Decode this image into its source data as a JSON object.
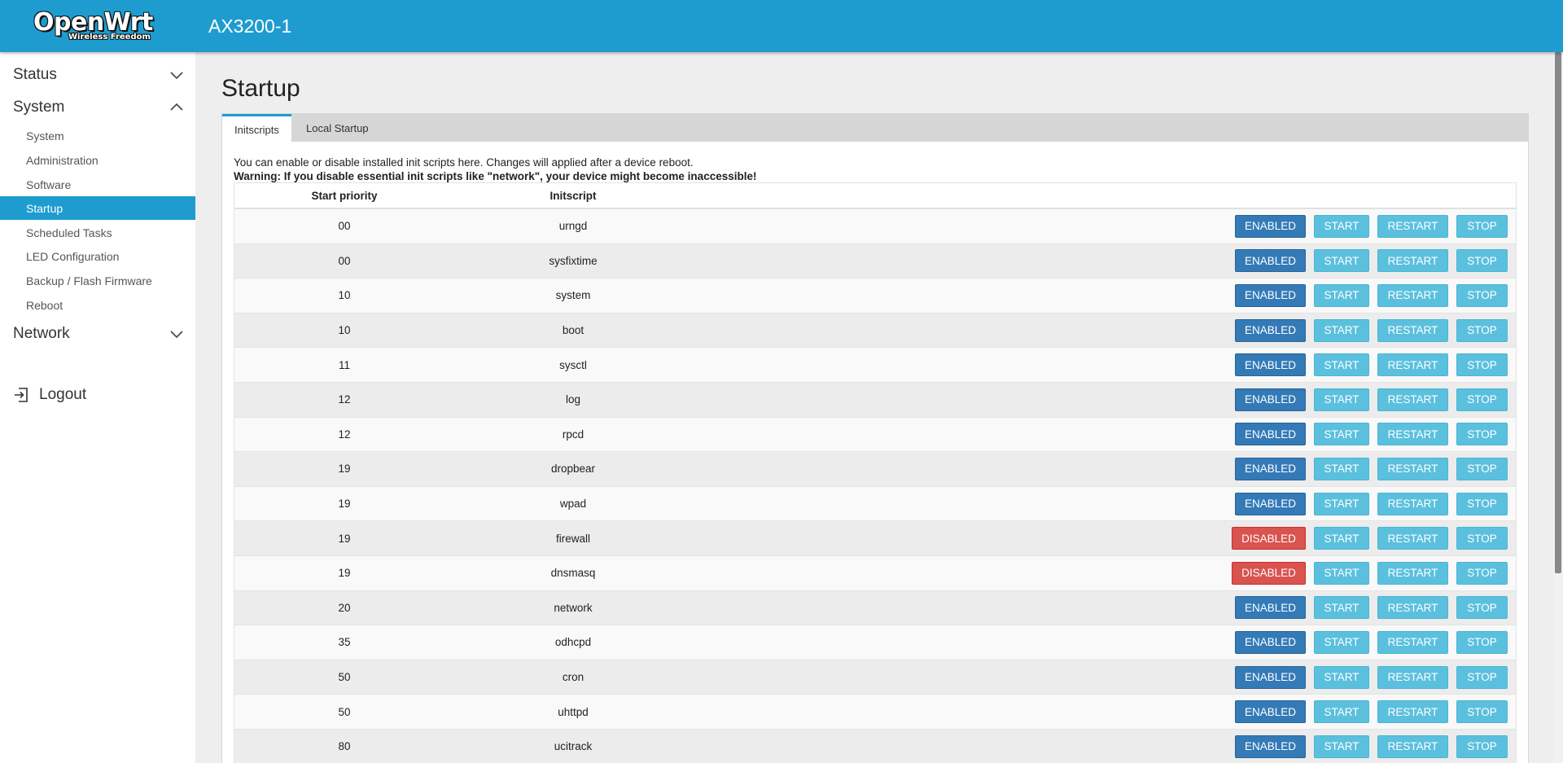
{
  "header": {
    "logo_main": "OpenWrt",
    "logo_sub": "Wireless Freedom",
    "hostname": "AX3200-1"
  },
  "sidebar": {
    "status_label": "Status",
    "system_label": "System",
    "network_label": "Network",
    "logout_label": "Logout",
    "system_items": [
      {
        "label": "System"
      },
      {
        "label": "Administration"
      },
      {
        "label": "Software"
      },
      {
        "label": "Startup"
      },
      {
        "label": "Scheduled Tasks"
      },
      {
        "label": "LED Configuration"
      },
      {
        "label": "Backup / Flash Firmware"
      },
      {
        "label": "Reboot"
      }
    ],
    "active_item": "Startup"
  },
  "main": {
    "title": "Startup",
    "tabs": [
      {
        "label": "Initscripts"
      },
      {
        "label": "Local Startup"
      }
    ],
    "description": "You can enable or disable installed init scripts here. Changes will applied after a device reboot.",
    "warning": "Warning: If you disable essential init scripts like \"network\", your device might become inaccessible!",
    "table": {
      "headers": {
        "priority": "Start priority",
        "script": "Initscript"
      },
      "start_label": "START",
      "restart_label": "RESTART",
      "stop_label": "STOP",
      "rows": [
        {
          "priority": "00",
          "script": "urngd",
          "state": "ENABLED"
        },
        {
          "priority": "00",
          "script": "sysfixtime",
          "state": "ENABLED"
        },
        {
          "priority": "10",
          "script": "system",
          "state": "ENABLED"
        },
        {
          "priority": "10",
          "script": "boot",
          "state": "ENABLED"
        },
        {
          "priority": "11",
          "script": "sysctl",
          "state": "ENABLED"
        },
        {
          "priority": "12",
          "script": "log",
          "state": "ENABLED"
        },
        {
          "priority": "12",
          "script": "rpcd",
          "state": "ENABLED"
        },
        {
          "priority": "19",
          "script": "dropbear",
          "state": "ENABLED"
        },
        {
          "priority": "19",
          "script": "wpad",
          "state": "ENABLED"
        },
        {
          "priority": "19",
          "script": "firewall",
          "state": "DISABLED"
        },
        {
          "priority": "19",
          "script": "dnsmasq",
          "state": "DISABLED"
        },
        {
          "priority": "20",
          "script": "network",
          "state": "ENABLED"
        },
        {
          "priority": "35",
          "script": "odhcpd",
          "state": "ENABLED"
        },
        {
          "priority": "50",
          "script": "cron",
          "state": "ENABLED"
        },
        {
          "priority": "50",
          "script": "uhttpd",
          "state": "ENABLED"
        },
        {
          "priority": "80",
          "script": "ucitrack",
          "state": "ENABLED"
        }
      ]
    }
  },
  "colors": {
    "brand": "#1e9ccf",
    "enabled": "#337ab7",
    "disabled": "#d9534f",
    "action": "#5bc0de"
  }
}
